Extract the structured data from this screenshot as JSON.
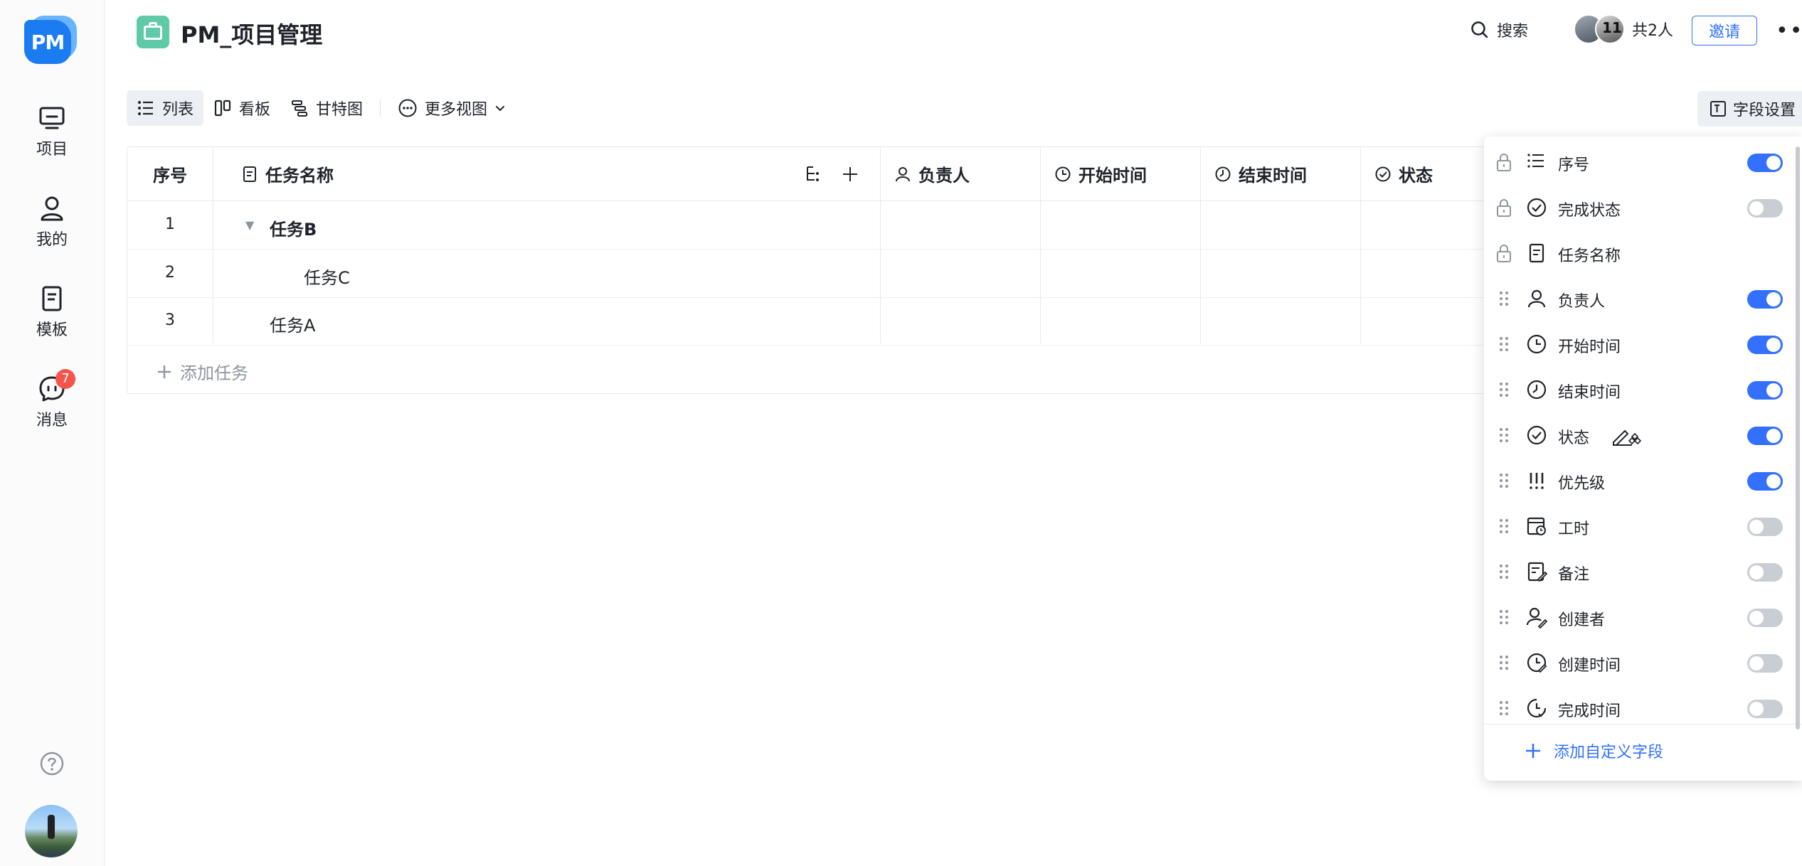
{
  "nav": {
    "logo_text": "PM",
    "items": [
      {
        "label": "项目",
        "icon": "monitor-icon"
      },
      {
        "label": "我的",
        "icon": "user-icon"
      },
      {
        "label": "模板",
        "icon": "template-icon"
      },
      {
        "label": "消息",
        "icon": "message-icon",
        "badge": "7"
      }
    ]
  },
  "header": {
    "project_title": "PM_项目管理",
    "search_label": "搜索",
    "members_count": "共2人",
    "invite_label": "邀请",
    "more": "•••"
  },
  "views": {
    "list": "列表",
    "kanban": "看板",
    "gantt": "甘特图",
    "more_views": "更多视图",
    "field_settings": "字段设置"
  },
  "table": {
    "columns": [
      "序号",
      "任务名称",
      "负责人",
      "开始时间",
      "结束时间",
      "状态"
    ],
    "rows": [
      {
        "no": "1",
        "name": "任务B",
        "bold": true,
        "expand": "▼"
      },
      {
        "no": "2",
        "name": "任务C",
        "bold": false
      },
      {
        "no": "3",
        "name": "任务A",
        "bold": false
      }
    ],
    "add_task": "添加任务"
  },
  "field_panel": {
    "fields": [
      {
        "label": "序号",
        "locked": true,
        "on": true
      },
      {
        "label": "完成状态",
        "locked": true,
        "on": false
      },
      {
        "label": "任务名称",
        "locked": true,
        "on": null
      },
      {
        "label": "负责人",
        "locked": false,
        "on": true
      },
      {
        "label": "开始时间",
        "locked": false,
        "on": true
      },
      {
        "label": "结束时间",
        "locked": false,
        "on": true
      },
      {
        "label": "状态",
        "locked": false,
        "on": true,
        "editable": true
      },
      {
        "label": "优先级",
        "locked": false,
        "on": true
      },
      {
        "label": "工时",
        "locked": false,
        "on": false
      },
      {
        "label": "备注",
        "locked": false,
        "on": false
      },
      {
        "label": "创建者",
        "locked": false,
        "on": false
      },
      {
        "label": "创建时间",
        "locked": false,
        "on": false
      },
      {
        "label": "完成时间",
        "locked": false,
        "on": false
      }
    ],
    "add_custom_field": "添加自定义字段"
  },
  "colors": {
    "accent": "#3370ff",
    "badge": "#f5544a",
    "project_icon": "#5ecaa7",
    "logo": "#1a7cf0"
  }
}
